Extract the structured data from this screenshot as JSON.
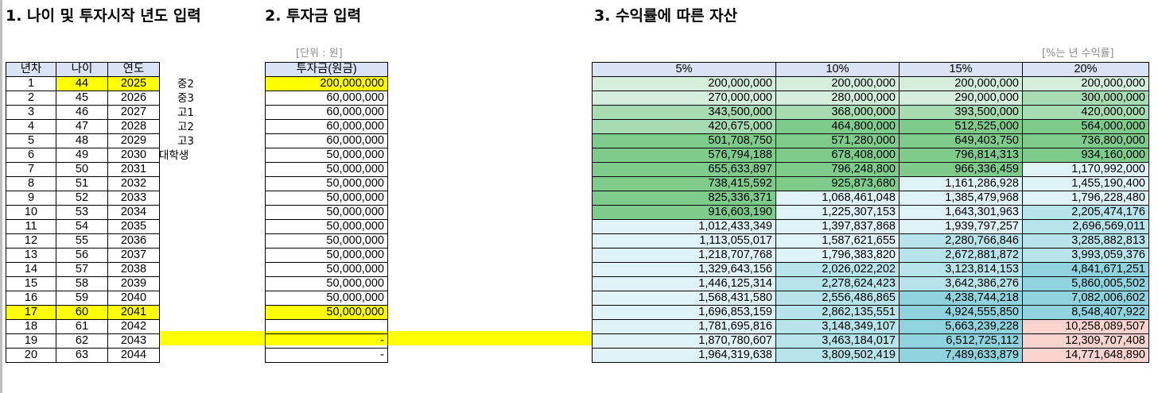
{
  "headings": {
    "input_age_year": "1. 나이 및 투자시작 년도 입력",
    "input_investment": "2. 투자금 입력",
    "assets_by_return": "3. 수익률에 따른 자산"
  },
  "unit_notes": {
    "won": "[단위 : 원]",
    "percent": "[%는 년 수익률]"
  },
  "left_table": {
    "headers": [
      "년차",
      "나이",
      "연도"
    ],
    "rows": [
      [
        "1",
        "44",
        "2025"
      ],
      [
        "2",
        "45",
        "2026"
      ],
      [
        "3",
        "46",
        "2027"
      ],
      [
        "4",
        "47",
        "2028"
      ],
      [
        "5",
        "48",
        "2029"
      ],
      [
        "6",
        "49",
        "2030"
      ],
      [
        "7",
        "50",
        "2031"
      ],
      [
        "8",
        "51",
        "2032"
      ],
      [
        "9",
        "52",
        "2033"
      ],
      [
        "10",
        "53",
        "2034"
      ],
      [
        "11",
        "54",
        "2035"
      ],
      [
        "12",
        "55",
        "2036"
      ],
      [
        "13",
        "56",
        "2037"
      ],
      [
        "14",
        "57",
        "2038"
      ],
      [
        "15",
        "58",
        "2039"
      ],
      [
        "16",
        "59",
        "2040"
      ],
      [
        "17",
        "60",
        "2041"
      ],
      [
        "18",
        "61",
        "2042"
      ],
      [
        "19",
        "62",
        "2043"
      ],
      [
        "20",
        "63",
        "2044"
      ]
    ]
  },
  "grade_labels": [
    "중2",
    "중3",
    "고1",
    "고2",
    "고3",
    "대학생"
  ],
  "investment_table": {
    "header": "투자금(원금)",
    "values": [
      "200,000,000",
      "60,000,000",
      "60,000,000",
      "60,000,000",
      "60,000,000",
      "50,000,000",
      "50,000,000",
      "50,000,000",
      "50,000,000",
      "50,000,000",
      "50,000,000",
      "50,000,000",
      "50,000,000",
      "50,000,000",
      "50,000,000",
      "50,000,000",
      "50,000,000",
      "",
      "-",
      "-"
    ]
  },
  "returns_table": {
    "headers": [
      "5%",
      "10%",
      "15%",
      "20%"
    ],
    "rows": [
      [
        "200,000,000",
        "200,000,000",
        "200,000,000",
        "200,000,000"
      ],
      [
        "270,000,000",
        "280,000,000",
        "290,000,000",
        "300,000,000"
      ],
      [
        "343,500,000",
        "368,000,000",
        "393,500,000",
        "420,000,000"
      ],
      [
        "420,675,000",
        "464,800,000",
        "512,525,000",
        "564,000,000"
      ],
      [
        "501,708,750",
        "571,280,000",
        "649,403,750",
        "736,800,000"
      ],
      [
        "576,794,188",
        "678,408,000",
        "796,814,313",
        "934,160,000"
      ],
      [
        "655,633,897",
        "796,248,800",
        "966,336,459",
        "1,170,992,000"
      ],
      [
        "738,415,592",
        "925,873,680",
        "1,161,286,928",
        "1,455,190,400"
      ],
      [
        "825,336,371",
        "1,068,461,048",
        "1,385,479,968",
        "1,796,228,480"
      ],
      [
        "916,603,190",
        "1,225,307,153",
        "1,643,301,963",
        "2,205,474,176"
      ],
      [
        "1,012,433,349",
        "1,397,837,868",
        "1,939,797,257",
        "2,696,569,011"
      ],
      [
        "1,113,055,017",
        "1,587,621,655",
        "2,280,766,846",
        "3,285,882,813"
      ],
      [
        "1,218,707,768",
        "1,796,383,820",
        "2,672,881,872",
        "3,993,059,376"
      ],
      [
        "1,329,643,156",
        "2,026,022,202",
        "3,123,814,153",
        "4,841,671,251"
      ],
      [
        "1,446,125,314",
        "2,278,624,423",
        "3,642,386,276",
        "5,860,005,502"
      ],
      [
        "1,568,431,580",
        "2,556,486,865",
        "4,238,744,218",
        "7,082,006,602"
      ],
      [
        "1,696,853,159",
        "2,862,135,551",
        "4,924,555,850",
        "8,548,407,922"
      ],
      [
        "1,781,695,816",
        "3,148,349,107",
        "5,663,239,228",
        "10,258,089,507"
      ],
      [
        "1,870,780,607",
        "3,463,184,017",
        "6,512,725,112",
        "12,309,707,408"
      ],
      [
        "1,964,319,638",
        "3,809,502,419",
        "7,489,633,879",
        "14,771,648,890"
      ]
    ],
    "colors": {
      "header": "#dae3f3",
      "green_light": "#d4eedb",
      "green_mid": "#a7dbb2",
      "green_dark": "#7fcb8c",
      "cyan_light": "#dff2f5",
      "cyan_mid": "#b7e4ea",
      "cyan_dark": "#8fd3de",
      "pink": "#f9d4cf"
    }
  },
  "highlight_color": "#ffff00"
}
